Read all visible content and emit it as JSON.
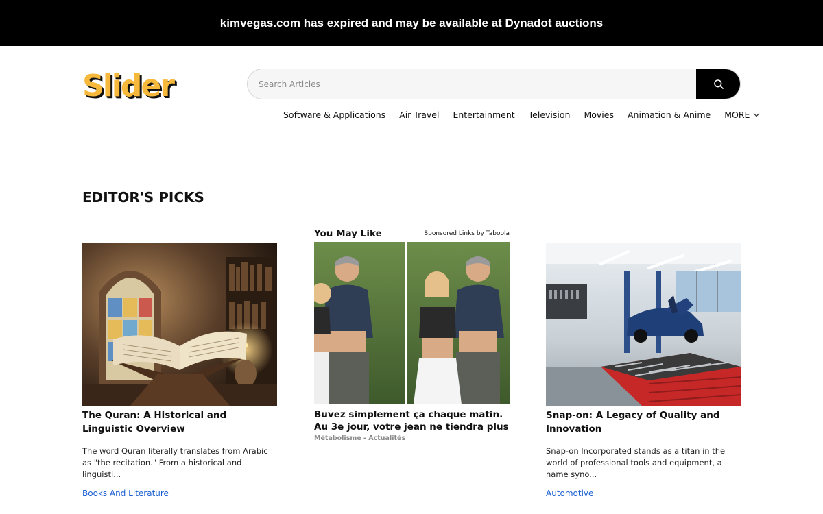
{
  "banner": {
    "text": "kimvegas.com has expired and may be available at Dynadot auctions"
  },
  "header": {
    "logo_text": "Slider",
    "search": {
      "placeholder": "Search Articles",
      "value": "",
      "button_icon": "search-icon"
    },
    "nav": [
      "Software & Applications",
      "Air Travel",
      "Entertainment",
      "Television",
      "Movies",
      "Animation & Anime"
    ],
    "nav_more_label": "MORE",
    "nav_more_icon": "chevron-down-icon"
  },
  "colors": {
    "logo": "#f6b93b",
    "banner_bg": "#000000",
    "category_link": "#1a5fd0",
    "search_button": "#000000"
  },
  "main": {
    "section_title": "EDITOR'S PICKS",
    "cards": [
      {
        "title": "The Quran: A Historical and Linguistic Overview",
        "excerpt": "The word Quran literally translates from Arabic as \"the recitation.\" From a historical and linguisti...",
        "category": "Books And Literature"
      },
      {
        "title": "Snap-on: A Legacy of Quality and Innovation",
        "excerpt": "Snap-on Incorporated stands as a titan in the world of professional tools and equipment, a name syno...",
        "category": "Automotive"
      }
    ],
    "ad": {
      "heading": "You May Like",
      "sponsor_label": "Sponsored Links by Taboola",
      "title": "Buvez simplement ça chaque matin. Au 3e jour, votre jean ne tiendra plus",
      "source": "Métabolisme - Actualités"
    }
  }
}
